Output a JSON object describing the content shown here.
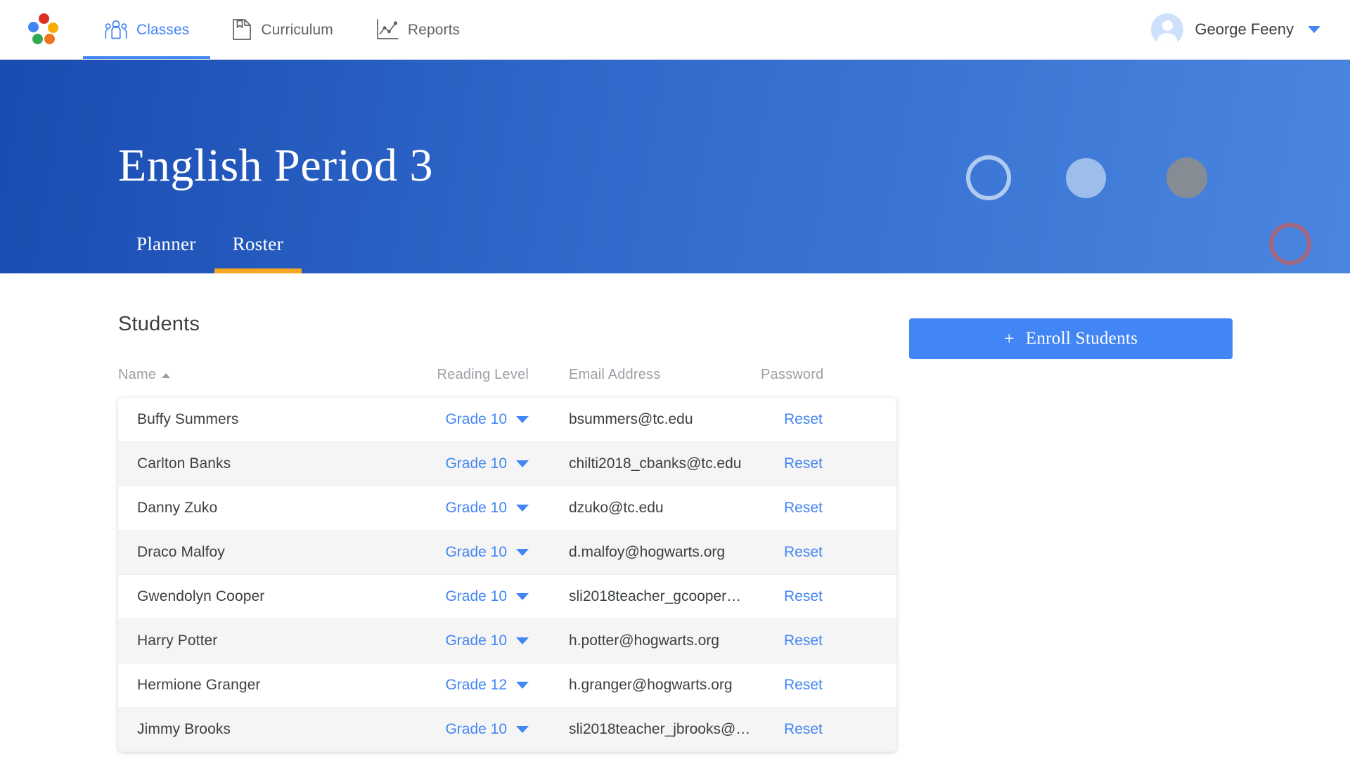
{
  "app": {
    "logo_name": "app-logo-dots",
    "logo_colors": [
      "#d93025",
      "#f9ab00",
      "#f0741e",
      "#34a853",
      "#4285f4"
    ]
  },
  "topnav": {
    "tabs": [
      {
        "label": "Classes",
        "icon": "people-group-icon",
        "active": true
      },
      {
        "label": "Curriculum",
        "icon": "document-bookmark-icon",
        "active": false
      },
      {
        "label": "Reports",
        "icon": "line-chart-icon",
        "active": false
      }
    ],
    "user": {
      "name": "George Feeny",
      "avatar_icon": "user-avatar-icon",
      "caret_icon": "chevron-down-icon"
    },
    "accent_color": "#4285f4"
  },
  "hero": {
    "title": "English Period 3",
    "gradient_from": "#1a4bb0",
    "gradient_to": "#4a86e0",
    "underline_color": "#f5a623",
    "tabs": [
      {
        "label": "Planner",
        "active": false
      },
      {
        "label": "Roster",
        "active": true
      }
    ]
  },
  "main": {
    "section_title": "Students",
    "enroll_button": {
      "label": "Enroll Students",
      "plus": "+",
      "color": "#4285f4"
    },
    "columns": {
      "name": "Name",
      "reading_level": "Reading Level",
      "email": "Email Address",
      "password": "Password"
    },
    "sort": {
      "column": "Name",
      "direction": "asc",
      "icon": "sort-ascending-icon"
    },
    "reset_label": "Reset",
    "students": [
      {
        "name": "Buffy Summers",
        "reading_level": "Grade 10",
        "email": "bsummers@tc.edu",
        "password": "Reset"
      },
      {
        "name": "Carlton Banks",
        "reading_level": "Grade 10",
        "email": "chilti2018_cbanks@tc.edu",
        "password": "Reset"
      },
      {
        "name": "Danny Zuko",
        "reading_level": "Grade 10",
        "email": "dzuko@tc.edu",
        "password": "Reset"
      },
      {
        "name": "Draco Malfoy",
        "reading_level": "Grade 10",
        "email": "d.malfoy@hogwarts.org",
        "password": "Reset"
      },
      {
        "name": "Gwendolyn Cooper",
        "reading_level": "Grade 10",
        "email": "sli2018teacher_gcooper…",
        "password": "Reset"
      },
      {
        "name": "Harry Potter",
        "reading_level": "Grade 10",
        "email": "h.potter@hogwarts.org",
        "password": "Reset"
      },
      {
        "name": "Hermione Granger",
        "reading_level": "Grade 12",
        "email": "h.granger@hogwarts.org",
        "password": "Reset"
      },
      {
        "name": "Jimmy Brooks",
        "reading_level": "Grade 10",
        "email": "sli2018teacher_jbrooks@…",
        "password": "Reset"
      }
    ]
  }
}
